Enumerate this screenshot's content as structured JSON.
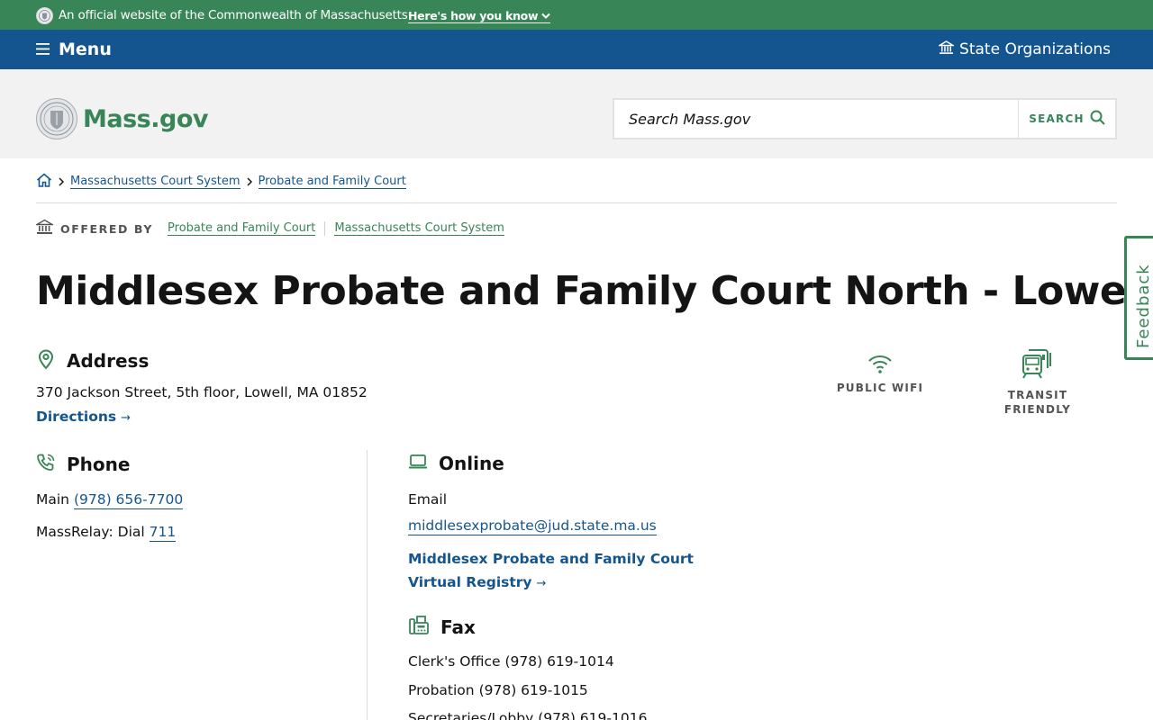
{
  "official_bar": {
    "text": "An official website of the Commonwealth of Massachusetts",
    "how_link": "Here's how you know"
  },
  "nav": {
    "menu_label": "Menu",
    "state_orgs_label": "State Organizations"
  },
  "header": {
    "logo_text": "Mass.gov",
    "search_placeholder": "Search Mass.gov",
    "search_button": "SEARCH"
  },
  "breadcrumb": {
    "items": [
      "Massachusetts Court System",
      "Probate and Family Court"
    ]
  },
  "offered_by": {
    "label": "OFFERED BY",
    "links": [
      "Probate and Family Court",
      "Massachusetts Court System"
    ]
  },
  "page_title": "Middlesex Probate and Family Court North - Lowell",
  "address": {
    "heading": "Address",
    "line": "370 Jackson Street, 5th floor, Lowell, MA 01852",
    "directions": "Directions"
  },
  "amenities": [
    {
      "label": "PUBLIC WIFI",
      "icon": "wifi-icon"
    },
    {
      "label": "TRANSIT FRIENDLY",
      "line1": "TRANSIT",
      "line2": "FRIENDLY",
      "icon": "transit-icon"
    }
  ],
  "phone": {
    "heading": "Phone",
    "main_label": "Main",
    "main_number": "(978) 656-7700",
    "relay_label": "MassRelay: Dial",
    "relay_number": "711"
  },
  "online": {
    "heading": "Online",
    "email_label": "Email",
    "email": "middlesexprobate@jud.state.ma.us",
    "registry_line1": "Middlesex Probate and Family Court",
    "registry_line2": "Virtual Registry"
  },
  "fax": {
    "heading": "Fax",
    "rows": [
      {
        "label": "Clerk's Office",
        "number": "(978) 619-1014"
      },
      {
        "label": "Probation",
        "number": "(978) 619-1015"
      },
      {
        "label": "Secretaries/Lobby",
        "number": "(978) 619-1016"
      }
    ]
  },
  "feedback_label": "Feedback",
  "colors": {
    "green": "#388557",
    "blue": "#14558f",
    "header_bg": "#f2f2f2"
  }
}
